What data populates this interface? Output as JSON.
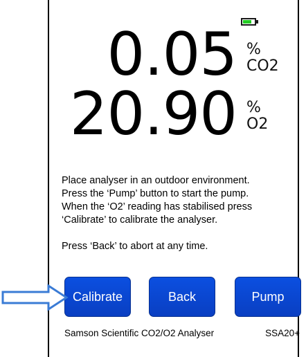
{
  "screen": {
    "battery": {
      "level": 0.75,
      "fill_color": "#22cc22",
      "icon": "battery-icon"
    },
    "co2": {
      "value": "0.05",
      "unit_symbol": "%",
      "unit_gas": "CO2"
    },
    "o2": {
      "value": "20.90",
      "unit_symbol": "%",
      "unit_gas": "O2"
    },
    "instructions": [
      "Place analyser in an outdoor environment.",
      "Press the ‘Pump’ button to start the pump.",
      "When the ‘O2’ reading has stabilised press",
      "‘Calibrate’ to calibrate the analyser.",
      "",
      "Press ‘Back’ to abort at any time."
    ],
    "buttons": {
      "calibrate": "Calibrate",
      "back": "Back",
      "pump": "Pump"
    },
    "button_color": "#0a47d6",
    "footer": {
      "product": "Samson Scientific CO2/O2 Analyser",
      "model": "SSA20+"
    }
  },
  "annotation": {
    "arrow_icon": "right-arrow-icon",
    "arrow_color": "#3a7bd5"
  }
}
